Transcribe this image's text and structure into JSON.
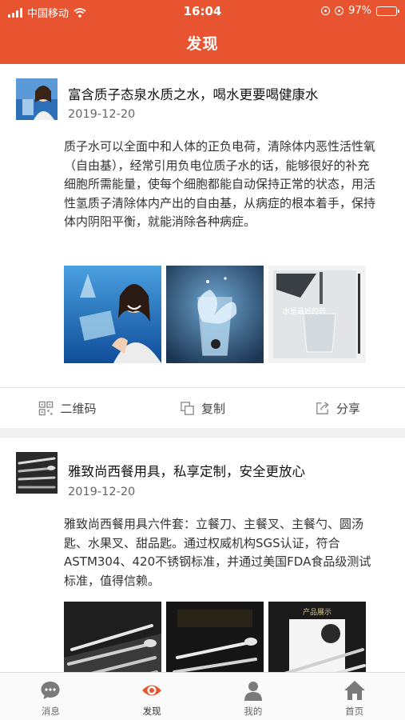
{
  "status_bar": {
    "carrier": "中国移动",
    "time": "16:04",
    "battery": "97%",
    "battery_level": 0.97
  },
  "header": {
    "title": "发现"
  },
  "feed": [
    {
      "title": "富含质子态泉水质之水，喝水更要喝健康水",
      "date": "2019-12-20",
      "body": "质子水可以全面中和人体的正负电荷，清除体内恶性活性氧（自由基），经常引用负电位质子水的话，能够很好的补充细胞所需能量，使每个细胞都能自动保持正常的状态，用活性氢质子清除体内产出的自由基，从病症的根本着手，保持体内阴阳平衡，就能消除各种病症。",
      "image3_caption": "水是最好的药"
    },
    {
      "title": "雅致尚西餐用具，私享定制，安全更放心",
      "date": "2019-12-20",
      "body": "雅致尚西餐用具六件套：立餐刀、主餐叉、主餐勺、圆汤匙、水果叉、甜品匙。通过权威机构SGS认证，符合ASTM304、420不锈钢标准，并通过美国FDA食品级测试标准，值得信赖。",
      "image3_caption": "产品展示"
    }
  ],
  "actions": {
    "qrcode": "二维码",
    "copy": "复制",
    "share": "分享"
  },
  "tabbar": {
    "messages": "消息",
    "discover": "发现",
    "mine": "我的",
    "home": "首页"
  },
  "colors": {
    "brand": "#e8542f",
    "active_tab": "#e8542f",
    "inactive_tab": "#7a7a7a"
  }
}
